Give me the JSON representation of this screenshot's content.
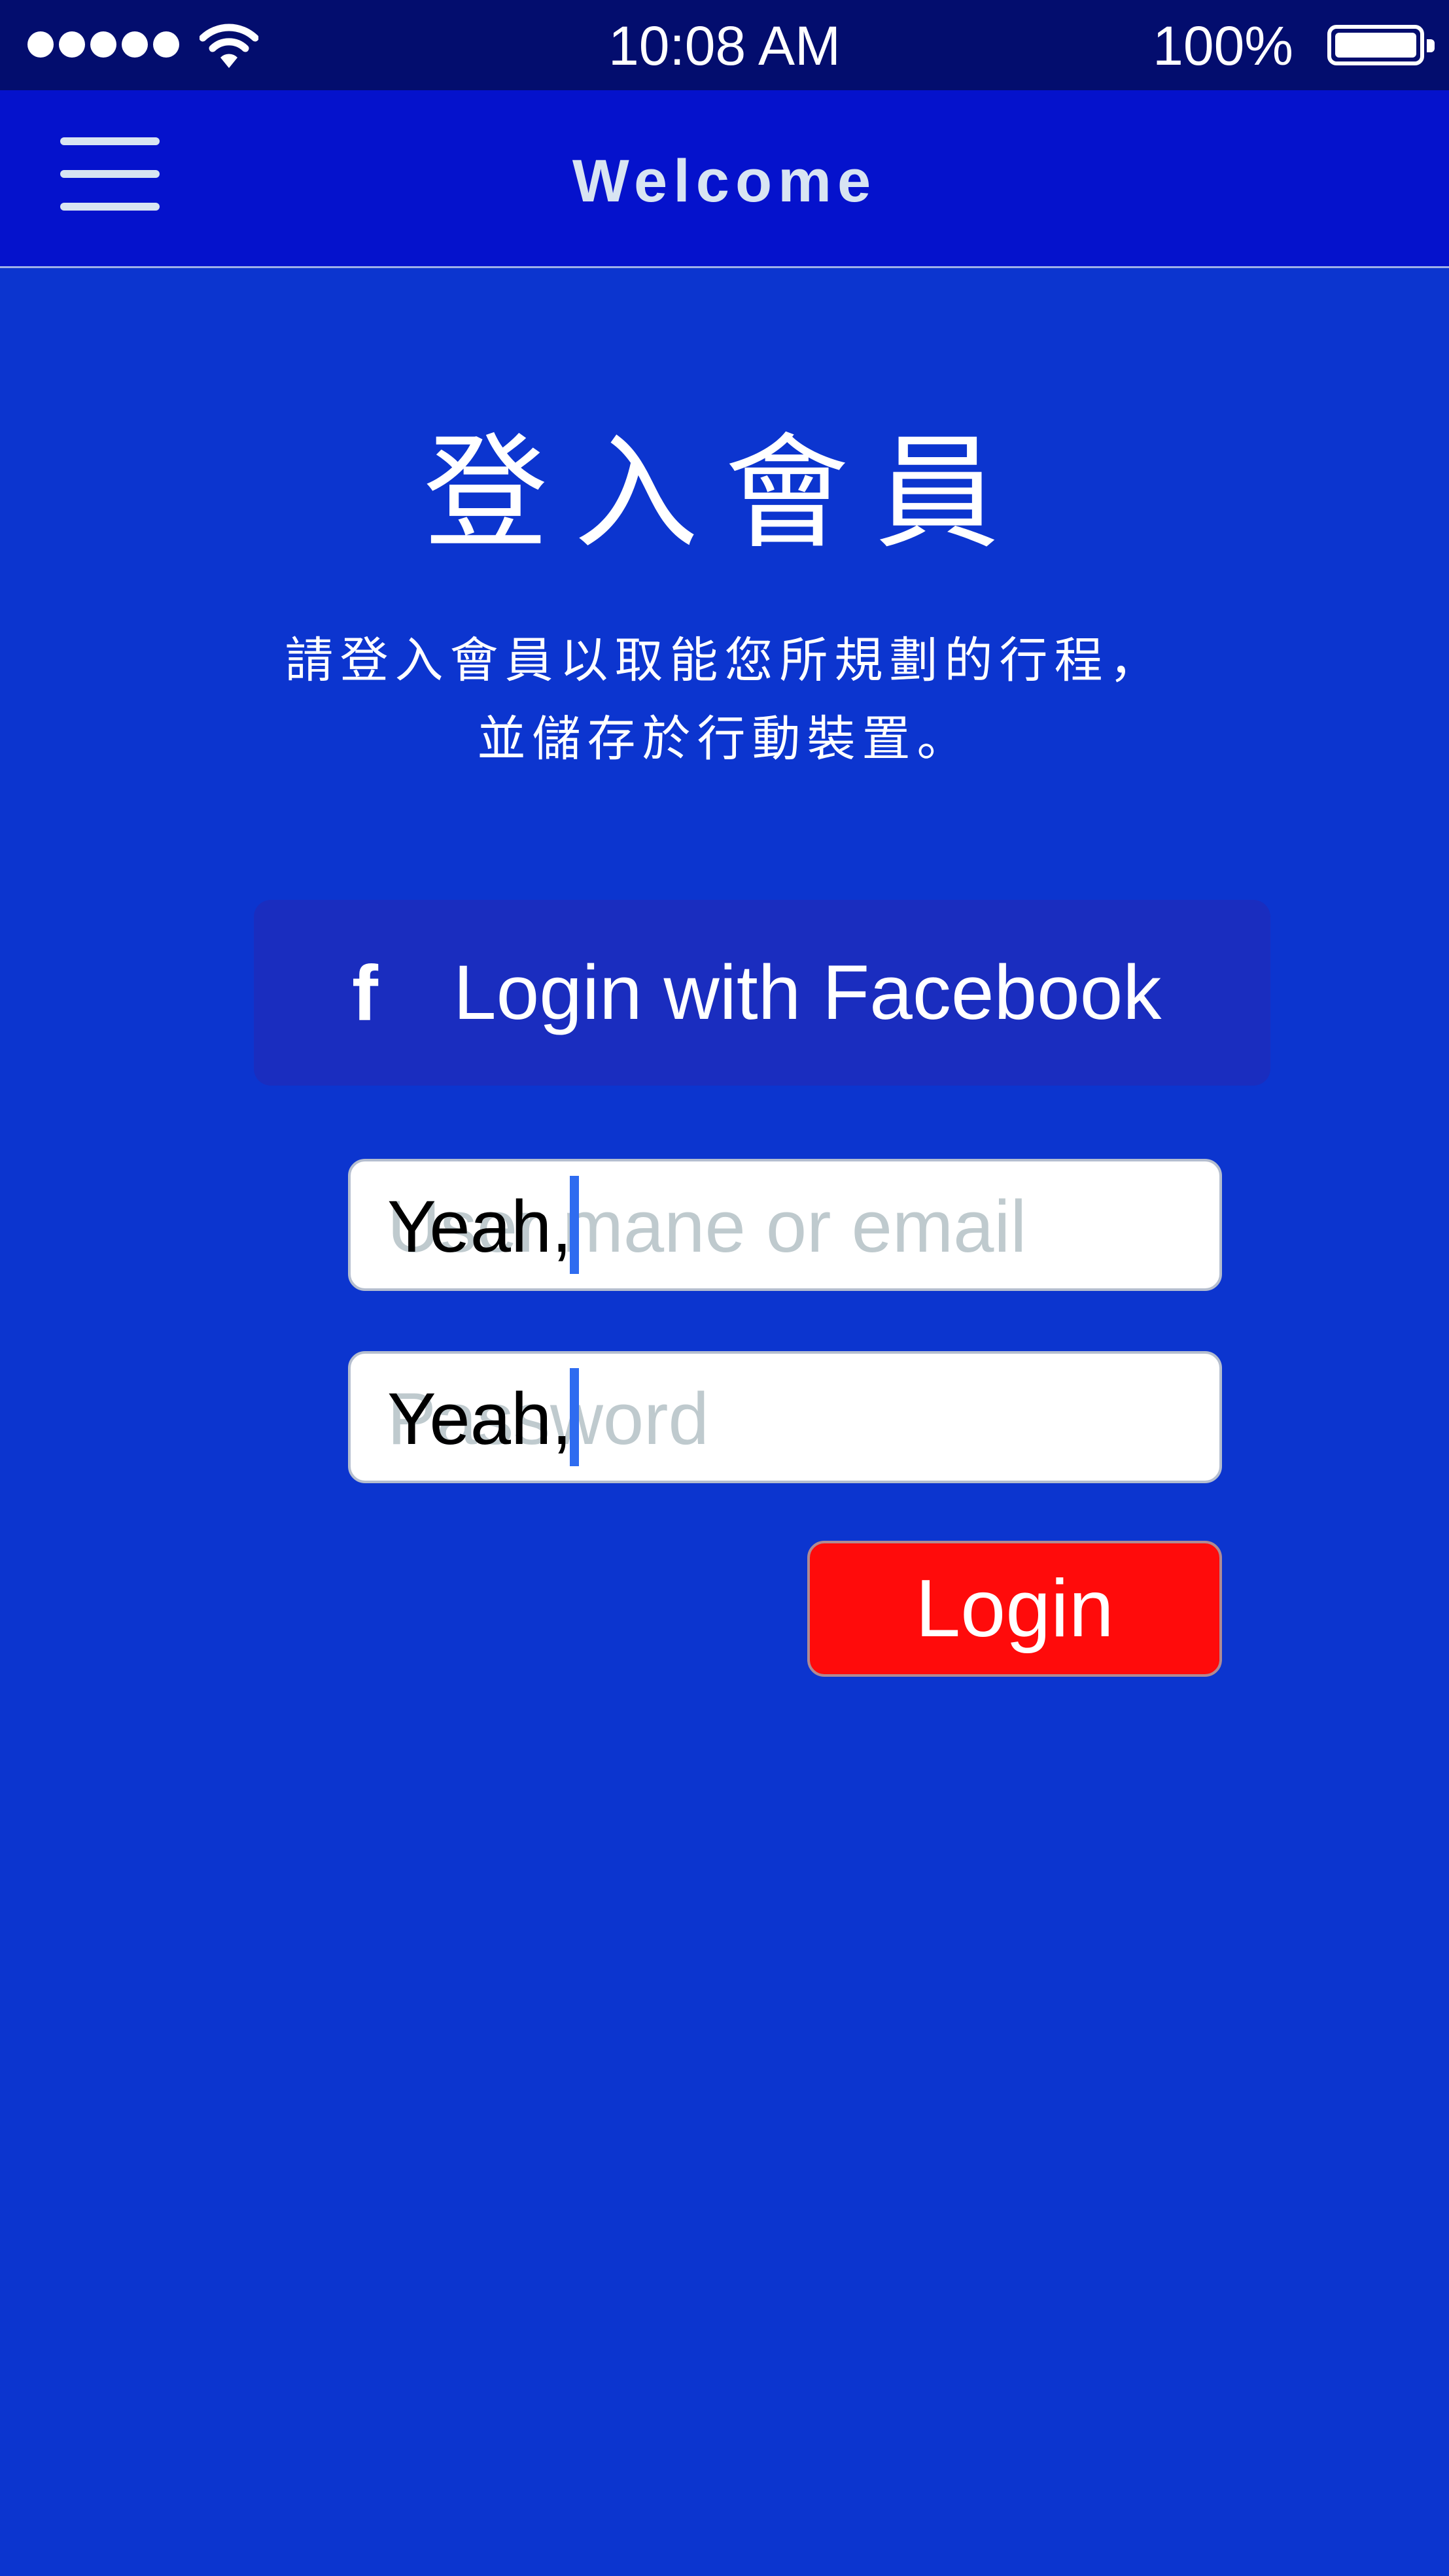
{
  "status_bar": {
    "time": "10:08 AM",
    "battery_percent": "100%",
    "battery_level": 1.0,
    "signal_bars": 5,
    "wifi_icon": "wifi-icon"
  },
  "nav": {
    "title": "Welcome",
    "menu_icon": "hamburger-menu-icon"
  },
  "main": {
    "title": "登入會員",
    "subtitle_line1": "請登入會員以取能您所規劃的行程，",
    "subtitle_line2": "並儲存於行動裝置。",
    "facebook_button": {
      "icon": "facebook-icon",
      "label": "Login with Facebook"
    },
    "username_field": {
      "placeholder": "User mane or email",
      "value": "Yeah,"
    },
    "password_field": {
      "placeholder": "Password",
      "value": "Yeah,"
    },
    "login_button": {
      "label": "Login"
    }
  },
  "colors": {
    "background": "#0C35CF",
    "status_bar": "#030D6E",
    "nav_bar": "#0512CC",
    "facebook_button": "#1A2DBF",
    "login_button": "#FF0B0B",
    "caret": "#2F6CF0"
  }
}
